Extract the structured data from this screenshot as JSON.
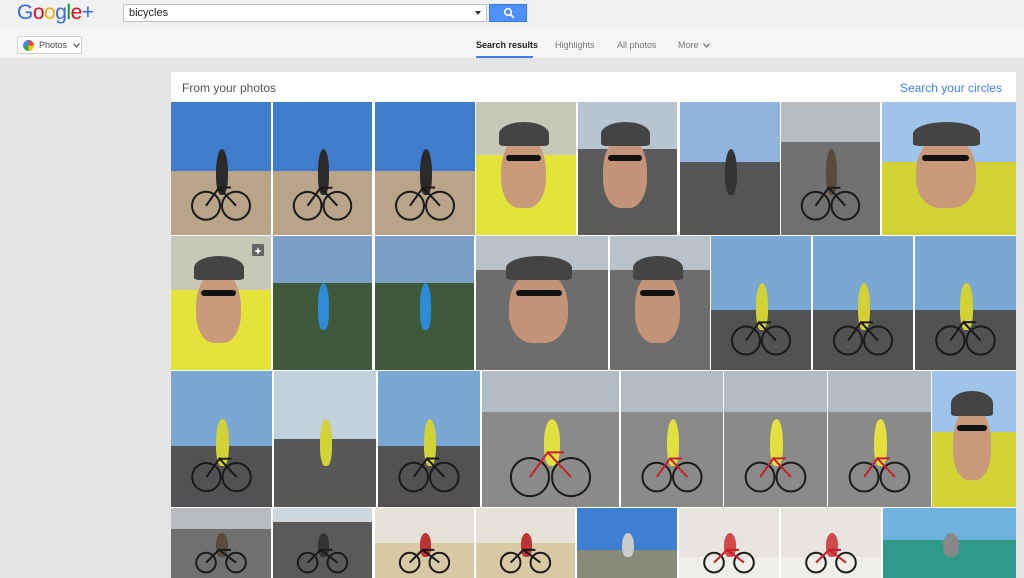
{
  "app": {
    "logo_letters": [
      {
        "ch": "G",
        "color": "#3369e8"
      },
      {
        "ch": "o",
        "color": "#d50f25"
      },
      {
        "ch": "o",
        "color": "#eeb211"
      },
      {
        "ch": "g",
        "color": "#3369e8"
      },
      {
        "ch": "l",
        "color": "#009925"
      },
      {
        "ch": "e",
        "color": "#d50f25"
      },
      {
        "ch": "+",
        "color": "#3369e8"
      }
    ]
  },
  "search": {
    "value": "bicycles"
  },
  "nav": {
    "photos_label": "Photos",
    "tabs": [
      {
        "label": "Search results"
      },
      {
        "label": "Highlights"
      },
      {
        "label": "All photos"
      },
      {
        "label": "More"
      }
    ]
  },
  "results": {
    "title": "From your photos",
    "link": "Search your circles"
  },
  "colors": {
    "accent": "#427fed",
    "search_button": "#4d90fe"
  }
}
